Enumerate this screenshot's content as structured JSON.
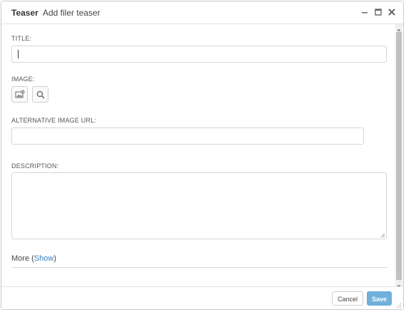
{
  "dialog": {
    "plugin_name": "Teaser",
    "title": "Add filer teaser"
  },
  "window_controls": {
    "minimize_icon": "minimize-icon",
    "maximize_icon": "maximize-icon",
    "close_icon": "close-icon"
  },
  "form": {
    "title_label": "TITLE:",
    "title_value": "",
    "image_label": "IMAGE:",
    "image_buttons": [
      "image-add-icon",
      "search-icon"
    ],
    "alt_url_label": "ALTERNATIVE IMAGE URL:",
    "alt_url_value": "",
    "description_label": "DESCRIPTION:",
    "description_value": ""
  },
  "more": {
    "prefix": "More (",
    "link": "Show",
    "suffix": ")"
  },
  "footer": {
    "cancel_label": "Cancel",
    "save_label": "Save"
  },
  "colors": {
    "save_button": "#6fb0dd",
    "link": "#3a7ebf",
    "border": "#d6d6d6"
  }
}
